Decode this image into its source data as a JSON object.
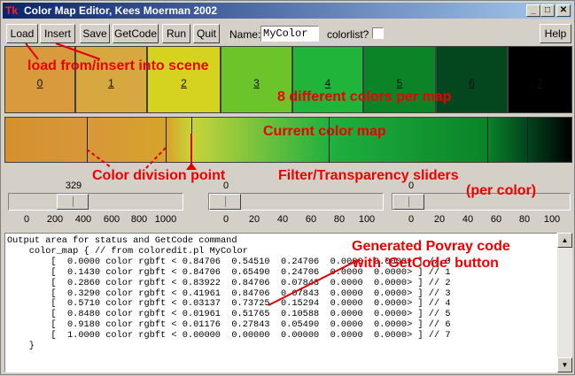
{
  "window": {
    "title": "Color Map Editor, Kees Moerman 2002",
    "app_icon": "Tk",
    "controls": [
      "_",
      "□",
      "✕"
    ]
  },
  "toolbar": {
    "load": "Load",
    "insert": "Insert",
    "save": "Save",
    "getcode": "GetCode",
    "run": "Run",
    "quit": "Quit",
    "name_label": "Name:",
    "name_value": "MyColor",
    "colorlist_label": "colorlist?",
    "help": "Help"
  },
  "swatches": [
    {
      "label": "0",
      "color": "#d89a3c"
    },
    {
      "label": "1",
      "color": "#d7a740"
    },
    {
      "label": "2",
      "color": "#d6d320"
    },
    {
      "label": "3",
      "color": "#6bc42a"
    },
    {
      "label": "4",
      "color": "#20b43a"
    },
    {
      "label": "5",
      "color": "#0b8428"
    },
    {
      "label": "6",
      "color": "#04471e"
    },
    {
      "label": "7",
      "color": "#000000"
    }
  ],
  "sliders": {
    "position": {
      "value": "329",
      "scale": [
        "0",
        "200",
        "400",
        "600",
        "800",
        "1000"
      ]
    },
    "filter": {
      "value": "0",
      "scale": [
        "0",
        "20",
        "40",
        "60",
        "80",
        "100"
      ]
    },
    "transmit": {
      "value": "0",
      "scale": [
        "0",
        "20",
        "40",
        "60",
        "80",
        "100"
      ]
    }
  },
  "output_lines": [
    "Output area for status and GetCode command",
    "    color_map { // from coloredit.pl MyColor",
    "        [  0.0000 color rgbft < 0.84706  0.54510  0.24706  0.0000  0.0000> ] // 0",
    "        [  0.1430 color rgbft < 0.84706  0.65490  0.24706  0.0000  0.0000> ] // 1",
    "        [  0.2860 color rgbft < 0.83922  0.84706  0.07843  0.0000  0.0000> ] // 2",
    "        [  0.3290 color rgbft < 0.41961  0.84706  0.07843  0.0000  0.0000> ] // 3",
    "        [  0.5710 color rgbft < 0.03137  0.73725  0.15294  0.0000  0.0000> ] // 4",
    "        [  0.8480 color rgbft < 0.01961  0.51765  0.10588  0.0000  0.0000> ] // 5",
    "        [  0.9180 color rgbft < 0.01176  0.27843  0.05490  0.0000  0.0000> ] // 6",
    "        [  1.0000 color rgbft < 0.00000  0.00000  0.00000  0.0000  0.0000> ] // 7",
    "    }"
  ],
  "annotations": {
    "load_insert": "load from/insert into scene",
    "colors_per_map": "8 different colors per map",
    "current_map": "Current color map",
    "division_point": "Color division point",
    "sliders": "Filter/Transparency sliders",
    "per_color": "(per color)",
    "generated_1": "Generated Povray code",
    "generated_2": "with 'GetCode' button"
  },
  "annotation_color": "#ee0000"
}
